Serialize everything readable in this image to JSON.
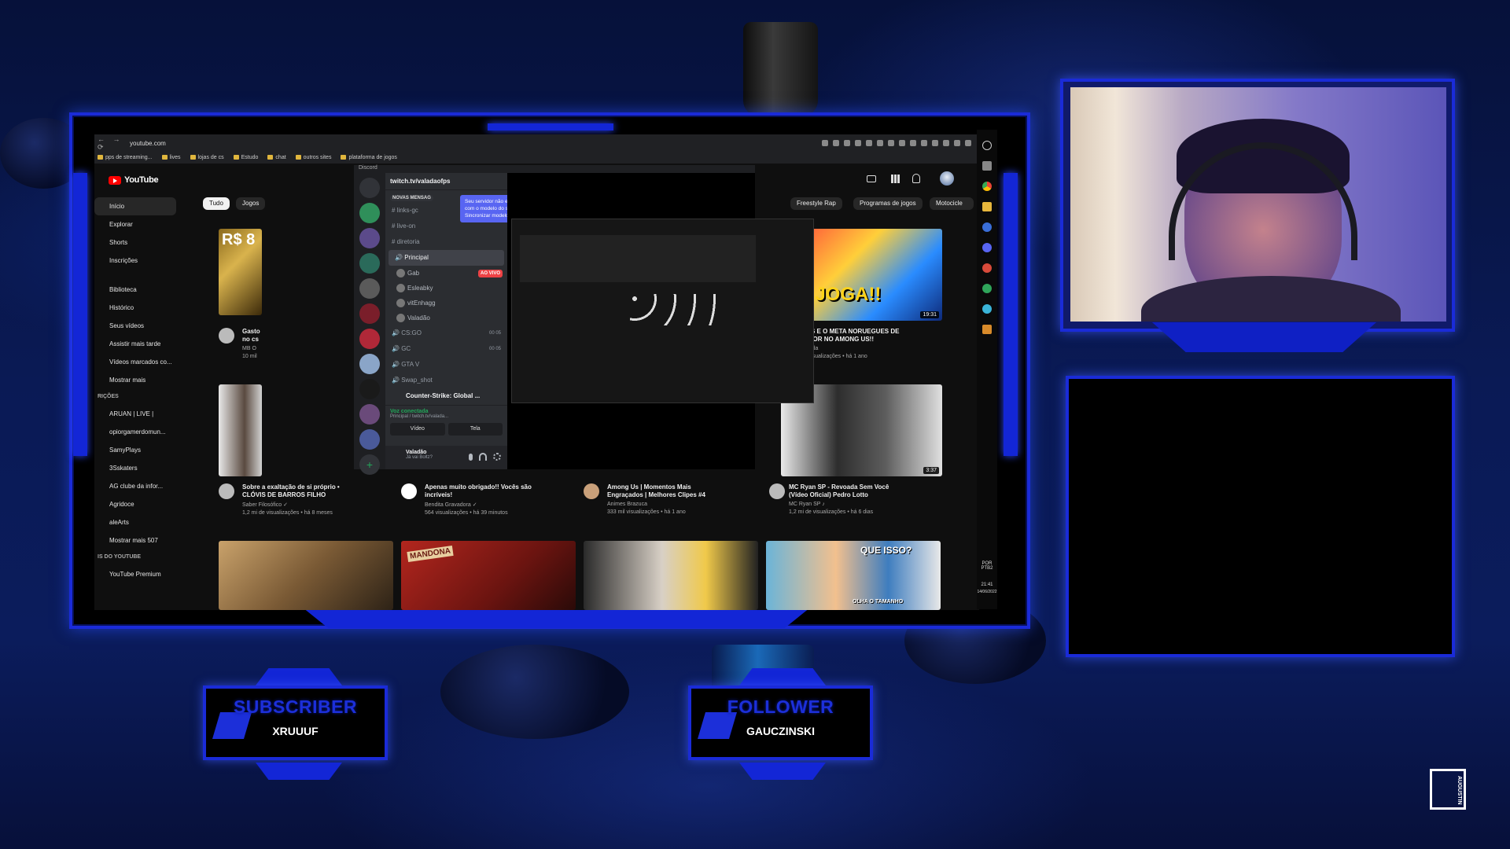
{
  "browser": {
    "url": "youtube.com",
    "bookmarks": [
      "pps de streaming...",
      "lives",
      "lojas de cs",
      "Estudo",
      "chat",
      "outros sites",
      "plataforma de jogos"
    ]
  },
  "youtube": {
    "logo_text": "YouTube",
    "sidebar": [
      {
        "label": "Início"
      },
      {
        "label": "Explorar"
      },
      {
        "label": "Shorts"
      },
      {
        "label": "Inscrições"
      },
      {
        "label": "Biblioteca"
      },
      {
        "label": "Histórico"
      },
      {
        "label": "Seus vídeos"
      },
      {
        "label": "Assistir mais tarde"
      },
      {
        "label": "Vídeos marcados co..."
      },
      {
        "label": "Mostrar mais"
      }
    ],
    "subs_header": "RIÇÕES",
    "subs": [
      {
        "label": "ARUAN | LIVE |"
      },
      {
        "label": "opiorgamerdomun..."
      },
      {
        "label": "SamyPlays"
      },
      {
        "label": "3Sskaters"
      },
      {
        "label": "AG clube da infor..."
      },
      {
        "label": "Agridoce"
      },
      {
        "label": "aleArts"
      },
      {
        "label": "Mostrar mais 507"
      }
    ],
    "more_header": "IS DO YOUTUBE",
    "premium": "YouTube Premium",
    "chips": [
      "Tudo",
      "Jogos",
      "Freestyle Rap",
      "Programas de jogos",
      "Motocicle"
    ],
    "partial_price": "R$ 8",
    "partial_title": "Gasto",
    "partial_line2": "no cs",
    "partial_line3": "MB O",
    "partial_line4": "10 mil",
    "videos": [
      {
        "title1": "GAULES E O META NORUEGUES DE",
        "title2": "IMPOSTOR NO AMONG US!!",
        "channel": "Amongzada",
        "views": "196 mil visualizações • há 1 ano",
        "duration": "19:31",
        "thumb_text": "LE JOGA!!"
      },
      {
        "title1": "MC Ryan SP - Revoada Sem Você",
        "title2": "(Vídeo Oficial) Pedro Lotto",
        "channel": "MC Ryan SP ♪",
        "views": "1,2 mi de visualizações • há 6 dias",
        "duration": "3:37"
      },
      {
        "title1": "Sobre a exaltação de si próprio •",
        "title2": "CLÓVIS DE BARROS FILHO",
        "channel": "Saber Filosófico ✓",
        "views": "1,2 mi de visualizações • há 8 meses"
      },
      {
        "title1": "Apenas muito obrigado!! Vocês são",
        "title2": "incríveis!",
        "channel": "Bendita Gravadora ✓",
        "views": "564 visualizações • há 39 minutos"
      },
      {
        "title1": "Among Us | Momentos Mais",
        "title2": "Engraçados | Melhores Clipes #4",
        "channel": "Animes Brazuca",
        "views": "333 mil visualizações • há 1 ano"
      }
    ],
    "bottom_thumb_text": "QUE ISSO?",
    "bottom_thumb_text2": "OLHA O TAMANHO",
    "bottom_thumb_text3": "MANDONA"
  },
  "discord": {
    "window_title": "Discord",
    "server_name": "twitch.tv/valadaofps",
    "new_messages": "NOVAS MENSAG",
    "tooltip": "Seu servidor não está sincronizado com o modelo do servidor. Sincronizar modelo?",
    "channels": [
      {
        "label": "# links-gc"
      },
      {
        "label": "# live-on"
      },
      {
        "label": "# diretoria"
      }
    ],
    "voice_channel": "Principal",
    "voice_users": [
      {
        "label": "Gab",
        "live": "AO VIVO"
      },
      {
        "label": "Esleabky"
      },
      {
        "label": "vitEnhagg"
      },
      {
        "label": "Valadão"
      }
    ],
    "other_channels": [
      {
        "label": "CS:GO",
        "count": "00 05"
      },
      {
        "label": "GC",
        "count": "00 05"
      },
      {
        "label": "GTA V"
      },
      {
        "label": "Swap_shot"
      }
    ],
    "now_playing": "Counter-Strike: Global ...",
    "voice_connected": "Voz conectada",
    "voice_sub": "Principal / twitch.tv/valada...",
    "btn_video": "Vídeo",
    "btn_screen": "Tela",
    "user_name": "Valadão",
    "user_status": "Já vai Boltz?"
  },
  "tray": {
    "lang": "POR PTB2",
    "time": "21:41",
    "date": "14/06/2022"
  },
  "alerts": {
    "subscriber_title": "SUBSCRIBER",
    "subscriber_name": "XRUUUF",
    "follower_title": "FOLLOWER",
    "follower_name": "GAUCZINSKI"
  },
  "brand": "AUGUSTIN"
}
